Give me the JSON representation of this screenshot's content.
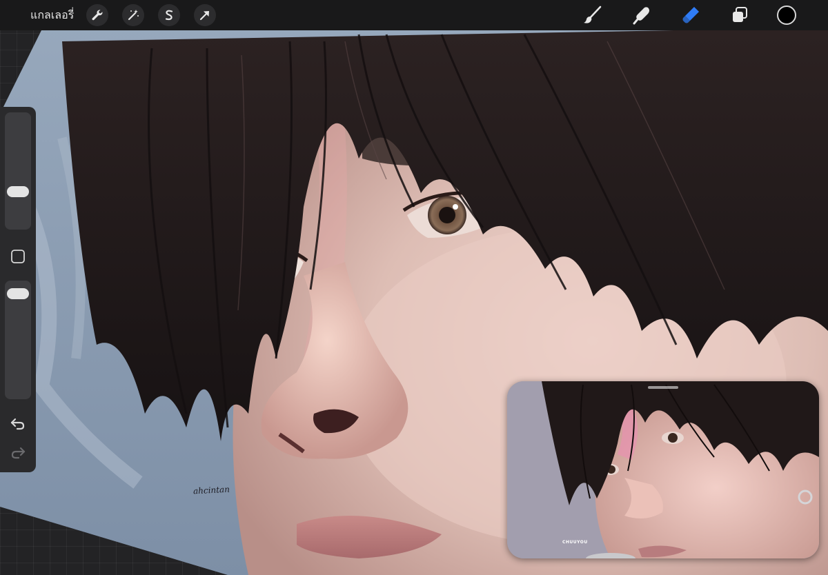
{
  "topbar": {
    "gallery_label": "แกลเลอรี่",
    "left_tools": [
      {
        "name": "actions",
        "icon": "wrench-icon"
      },
      {
        "name": "adjustments",
        "icon": "magic-wand-icon"
      },
      {
        "name": "selection",
        "icon": "selection-s-icon"
      },
      {
        "name": "transform",
        "icon": "arrow-cursor-icon"
      }
    ],
    "right_tools": [
      {
        "name": "brush",
        "icon": "brush-icon",
        "active": false
      },
      {
        "name": "smudge",
        "icon": "smudge-finger-icon",
        "active": false
      },
      {
        "name": "eraser",
        "icon": "eraser-icon",
        "active": true
      },
      {
        "name": "layers",
        "icon": "layers-icon",
        "active": false
      }
    ],
    "current_color": "#000000",
    "active_tool_color": "#2f7cf6"
  },
  "sidebar": {
    "brush_size": 0.3,
    "opacity": 0.95,
    "modify_icon": "square-icon",
    "undo_icon": "undo-icon",
    "redo_icon": "redo-icon"
  },
  "canvas": {
    "signature": "ahcintan"
  },
  "reference": {
    "caption": "CHUUYOU"
  }
}
